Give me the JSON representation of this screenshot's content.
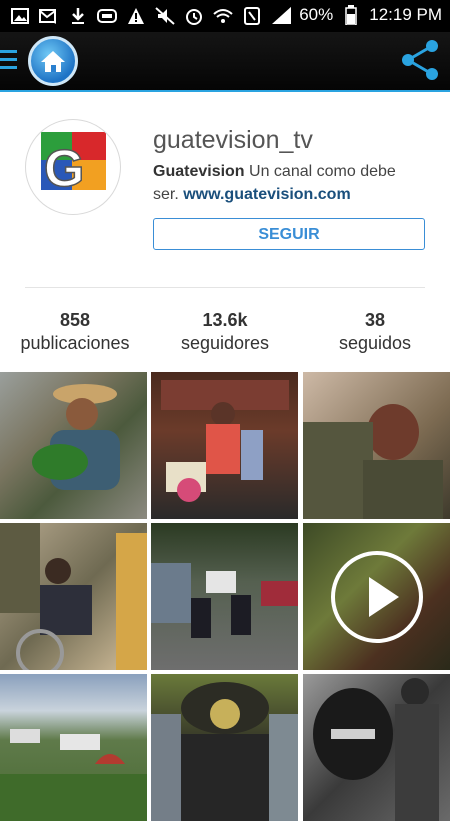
{
  "status_bar": {
    "battery": "60%",
    "time": "12:19 PM",
    "icons": [
      "image-icon",
      "mail-alert-icon",
      "download-icon",
      "screen-icon",
      "warning-icon",
      "mute-icon",
      "alarm-icon",
      "wifi-icon",
      "nfc-icon",
      "signal-icon",
      "battery-icon"
    ]
  },
  "app_bar": {
    "icons": [
      "menu-icon",
      "home-icon",
      "share-icon"
    ],
    "accent": "#2aa3e0"
  },
  "profile": {
    "username": "guatevision_tv",
    "bio_name": "Guatevision",
    "bio_text": " Un canal como debe ser. ",
    "bio_link": "www.guatevision.com",
    "follow_label": "SEGUIR",
    "logo_letter": "G"
  },
  "stats": [
    {
      "number": "858",
      "label": "publicaciones"
    },
    {
      "number": "13.6k",
      "label": "seguidores"
    },
    {
      "number": "38",
      "label": "seguidos"
    }
  ],
  "colors": {
    "follow_blue": "#3a8ed6",
    "link_blue": "#1a4f7c"
  }
}
